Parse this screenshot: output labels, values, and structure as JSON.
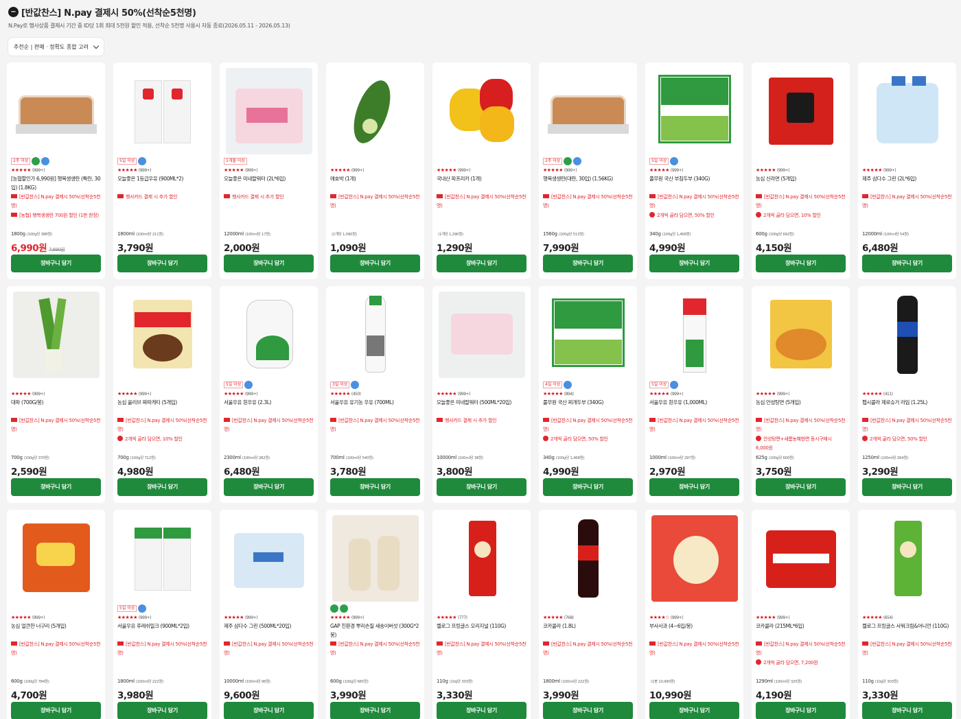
{
  "header": {
    "title": "[반값찬스] N.pay 결제시 50%(선착순5천명)",
    "subtitle": "N.Pay로 행사상품 결제시 기간 중 ID당 1회 최대 5천원 할인 적용, 선착순 5천명 사용시 자동 종료(2026.05.11 - 2026.05.13)",
    "sort_label": "추천순 | 판매 · 정확도 종합 고려"
  },
  "cart_label": "장바구니 담기",
  "colors": {
    "accent_green": "#1f8a3c",
    "promo_red": "#e1262d"
  },
  "products": [
    {
      "name": "[농협할인가 6,990원] 행복생생란 (특란, 30입) (1.8KG)",
      "badge": "2주 이상",
      "stars": "★★★★★",
      "count": "(999+)",
      "promos": [
        "[반값찬스] N.pay 결제시 50%(선착순5천명)",
        "[농협] 행복생생란 700원 할인 (1판 한정)"
      ],
      "unit": "1800g",
      "unit_sub": "(100g당 388원)",
      "price": "6,990원",
      "orig": "7,690원",
      "red": true,
      "dots": [
        "g",
        "b"
      ]
    },
    {
      "name": "오늘좋은 1등급우유 (900ML*2)",
      "badge": "5일 이상",
      "stars": "★★★★★",
      "count": "(999+)",
      "promos": [
        "행사카드 결제 시 추가 할인"
      ],
      "unit": "1800ml",
      "unit_sub": "(100ml당 211원)",
      "price": "3,790원",
      "dots": [
        "b"
      ]
    },
    {
      "name": "오늘좋은 미네랄워터 (2L*6입)",
      "badge": "1개월 이상",
      "stars": "★★★★★",
      "count": "(999+)",
      "promos": [
        "행사카드 결제 시 추가 할인"
      ],
      "unit": "12000ml",
      "unit_sub": "(100ml당 17원)",
      "price": "2,000원"
    },
    {
      "name": "애호박 (1개)",
      "stars": "★★★★★",
      "count": "(999+)",
      "promos": [
        "[반값찬스] N.pay 결제시 50%(선착순5천명)"
      ],
      "unit": "",
      "unit_sub": "(1개당 1,090원)",
      "price": "1,090원"
    },
    {
      "name": "국내산 파프리카 (1개)",
      "stars": "★★★★★",
      "count": "(999+)",
      "promos": [
        "[반값찬스] N.pay 결제시 50%(선착순5천명)"
      ],
      "unit": "",
      "unit_sub": "(1개당 1,290원)",
      "price": "1,290원"
    },
    {
      "name": "행복생생란(대란, 30입) (1.56KG)",
      "badge": "2주 이상",
      "stars": "★★★★★",
      "count": "(999+)",
      "promos": [
        "[반값찬스] N.pay 결제시 50%(선착순5천명)"
      ],
      "unit": "1560g",
      "unit_sub": "(100g당 513원)",
      "price": "7,990원",
      "dots": [
        "g",
        "b"
      ]
    },
    {
      "name": "풀무원 국산 부침두부 (340G)",
      "badge": "5일 이상",
      "stars": "★★★★★",
      "count": "(999+)",
      "promos": [
        "[반값찬스] N.pay 결제시 50%(선착순5천명)",
        "2개씩 골라 담으면, 50% 할인"
      ],
      "unit": "340g",
      "unit_sub": "(100g당 1,468원)",
      "price": "4,990원",
      "dots": [
        "b"
      ]
    },
    {
      "name": "농심 신라면 (5개입)",
      "stars": "★★★★★",
      "count": "(999+)",
      "promos": [
        "[반값찬스] N.pay 결제시 50%(선착순5천명)",
        "2개씩 골라 담으면, 10% 할인"
      ],
      "unit": "600g",
      "unit_sub": "(100g당 692원)",
      "price": "4,150원"
    },
    {
      "name": "제주 삼다수 그린 (2L*6입)",
      "stars": "★★★★★",
      "count": "(999+)",
      "promos": [
        "[반값찬스] N.pay 결제시 50%(선착순5천명)"
      ],
      "unit": "12000ml",
      "unit_sub": "(100ml당 54원)",
      "price": "6,480원"
    },
    {
      "name": "대파 (700G/봉)",
      "stars": "★★★★★",
      "count": "(999+)",
      "promos": [
        "[반값찬스] N.pay 결제시 50%(선착순5천명)"
      ],
      "unit": "700g",
      "unit_sub": "(100g당 370원)",
      "price": "2,590원"
    },
    {
      "name": "농심 올리브 짜파게티 (5개입)",
      "stars": "★★★★★",
      "count": "(999+)",
      "promos": [
        "[반값찬스] N.pay 결제시 50%(선착순5천명)",
        "2개씩 골라 담으면, 10% 할인"
      ],
      "unit": "700g",
      "unit_sub": "(100g당 712원)",
      "price": "4,980원"
    },
    {
      "name": "서울우유 흰우유 (2.3L)",
      "badge": "5일 이상",
      "stars": "★★★★★",
      "count": "(999+)",
      "promos": [
        "[반값찬스] N.pay 결제시 50%(선착순5천명)"
      ],
      "unit": "2300ml",
      "unit_sub": "(100ml당 282원)",
      "price": "6,480원",
      "dots": [
        "b"
      ]
    },
    {
      "name": "서울우유 유기농 우유 (700ML)",
      "badge": "3일 이상",
      "stars": "★★★★★",
      "count": "(450)",
      "promos": [
        "[반값찬스] N.pay 결제시 50%(선착순5천명)"
      ],
      "unit": "700ml",
      "unit_sub": "(100ml당 540원)",
      "price": "3,780원",
      "dots": [
        "b"
      ]
    },
    {
      "name": "오늘좋은 미네랄워터 (500ML*20입)",
      "stars": "★★★★★",
      "count": "(999+)",
      "promos": [
        "행사카드 결제 시 추가 할인"
      ],
      "unit": "10000ml",
      "unit_sub": "(100ml당 38원)",
      "price": "3,800원"
    },
    {
      "name": "풀무원 국산 찌개두부 (340G)",
      "badge": "4일 이상",
      "stars": "★★★★★",
      "count": "(894)",
      "promos": [
        "[반값찬스] N.pay 결제시 50%(선착순5천명)",
        "2개씩 골라 담으면, 50% 할인"
      ],
      "unit": "340g",
      "unit_sub": "(100g당 1,468원)",
      "price": "4,990원",
      "dots": [
        "b"
      ]
    },
    {
      "name": "서울우유 흰우유 (1,000ML)",
      "badge": "5일 이상",
      "stars": "★★★★★",
      "count": "(999+)",
      "promos": [
        "[반값찬스] N.pay 결제시 50%(선착순5천명)"
      ],
      "unit": "1000ml",
      "unit_sub": "(100ml당 297원)",
      "price": "2,970원",
      "dots": [
        "b"
      ]
    },
    {
      "name": "농심 안성탕면 (5개입)",
      "stars": "★★★★★",
      "count": "(999+)",
      "promos": [
        "[반값찬스] N.pay 결제시 50%(선착순5천명)",
        "안성탕면+새롬농혜현면 동시구매시 6,000원"
      ],
      "unit": "625g",
      "unit_sub": "(100g당 600원)",
      "price": "3,750원"
    },
    {
      "name": "펩시콜라 제로슈거 라임 (1.25L)",
      "stars": "★★★★★",
      "count": "(411)",
      "promos": [
        "[반값찬스] N.pay 결제시 50%(선착순5천명)",
        "2개씩 골라 담으면, 50% 할인"
      ],
      "unit": "1250ml",
      "unit_sub": "(100ml당 264원)",
      "price": "3,290원"
    },
    {
      "name": "농심 얼큰한 너구리 (5개입)",
      "stars": "★★★★★",
      "count": "(999+)",
      "promos": [
        "[반값찬스] N.pay 결제시 50%(선착순5천명)"
      ],
      "unit": "600g",
      "unit_sub": "(100g당 784원)",
      "price": "4,700원"
    },
    {
      "name": "서울우유 후레쉬밀크 (900ML*2입)",
      "badge": "5일 이상",
      "stars": "★★★★★",
      "count": "(999+)",
      "promos": [
        "[반값찬스] N.pay 결제시 50%(선착순5천명)"
      ],
      "unit": "1800ml",
      "unit_sub": "(100ml당 222원)",
      "price": "3,980원",
      "dots": [
        "b"
      ]
    },
    {
      "name": "제주 삼다수 그린 (500ML*20입)",
      "stars": "★★★★★",
      "count": "(999+)",
      "promos": [
        "[반값찬스] N.pay 결제시 50%(선착순5천명)"
      ],
      "unit": "10000ml",
      "unit_sub": "(100ml당 96원)",
      "price": "9,600원"
    },
    {
      "name": "GAP 친환경 뿌리손질 새송이버섯 (300G*2봉)",
      "stars": "★★★★★",
      "count": "(999+)",
      "promos": [
        "[반값찬스] N.pay 결제시 50%(선착순5천명)"
      ],
      "unit": "600g",
      "unit_sub": "(100g당 665원)",
      "price": "3,990원",
      "dots": [
        "g",
        "g"
      ]
    },
    {
      "name": "켈로그 프링글스 오리지널 (110G)",
      "stars": "★★★★★",
      "count": "(777)",
      "promos": [
        "[반값찬스] N.pay 결제시 50%(선착순5천명)"
      ],
      "unit": "110g",
      "unit_sub": "(10g당 303원)",
      "price": "3,330원"
    },
    {
      "name": "코카콜라 (1.8L)",
      "stars": "★★★★★",
      "count": "(768)",
      "promos": [
        "[반값찬스] N.pay 결제시 50%(선착순5천명)"
      ],
      "unit": "1800ml",
      "unit_sub": "(100ml당 222원)",
      "price": "3,990원"
    },
    {
      "name": "부사사과 (4~6입/봉)",
      "stars": "★★★★☆",
      "count": "(999+)",
      "promos": [
        "[반값찬스] N.pay 결제시 50%(선착순5천명)"
      ],
      "unit": "",
      "unit_sub": "(1봉 10,990원)",
      "price": "10,990원"
    },
    {
      "name": "코카콜라 (215ML*6입)",
      "stars": "★★★★★",
      "count": "(999+)",
      "promos": [
        "[반값찬스] N.pay 결제시 50%(선착순5천명)",
        "2개씩 골라 담으면, 7,200원"
      ],
      "unit": "1290ml",
      "unit_sub": "(100ml당 325원)",
      "price": "4,190원"
    },
    {
      "name": "켈로그 프링글스 사워크림&어니언 (110G)",
      "stars": "★★★★★",
      "count": "(654)",
      "promos": [
        "[반값찬스] N.pay 결제시 50%(선착순5천명)"
      ],
      "unit": "110g",
      "unit_sub": "(10g당 303원)",
      "price": "3,330원"
    }
  ]
}
